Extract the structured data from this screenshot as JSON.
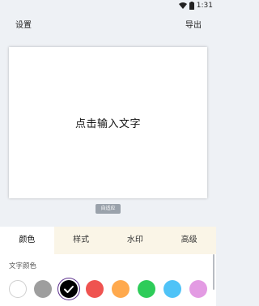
{
  "status_bar": {
    "time": "1:31",
    "wifi_icon": "wifi-icon",
    "battery_icon": "battery-icon"
  },
  "toolbar": {
    "settings_label": "设置",
    "export_label": "导出"
  },
  "canvas": {
    "placeholder_text": "点击输入文字"
  },
  "adapt_chip": {
    "label": "自适应"
  },
  "tabs": [
    {
      "label": "颜色",
      "active": true
    },
    {
      "label": "样式",
      "active": false
    },
    {
      "label": "水印",
      "active": false
    },
    {
      "label": "高级",
      "active": false
    }
  ],
  "color_section": {
    "title": "文字颜色",
    "swatches": [
      {
        "color": "#ffffff",
        "selected": false
      },
      {
        "color": "#9e9e9e",
        "selected": false
      },
      {
        "color": "#000000",
        "selected": true
      },
      {
        "color": "#ef5350",
        "selected": false
      },
      {
        "color": "#ffa94d",
        "selected": false
      },
      {
        "color": "#2ecc59",
        "selected": false
      },
      {
        "color": "#4fc3f7",
        "selected": false
      },
      {
        "color": "#e39be3",
        "selected": false
      }
    ]
  }
}
